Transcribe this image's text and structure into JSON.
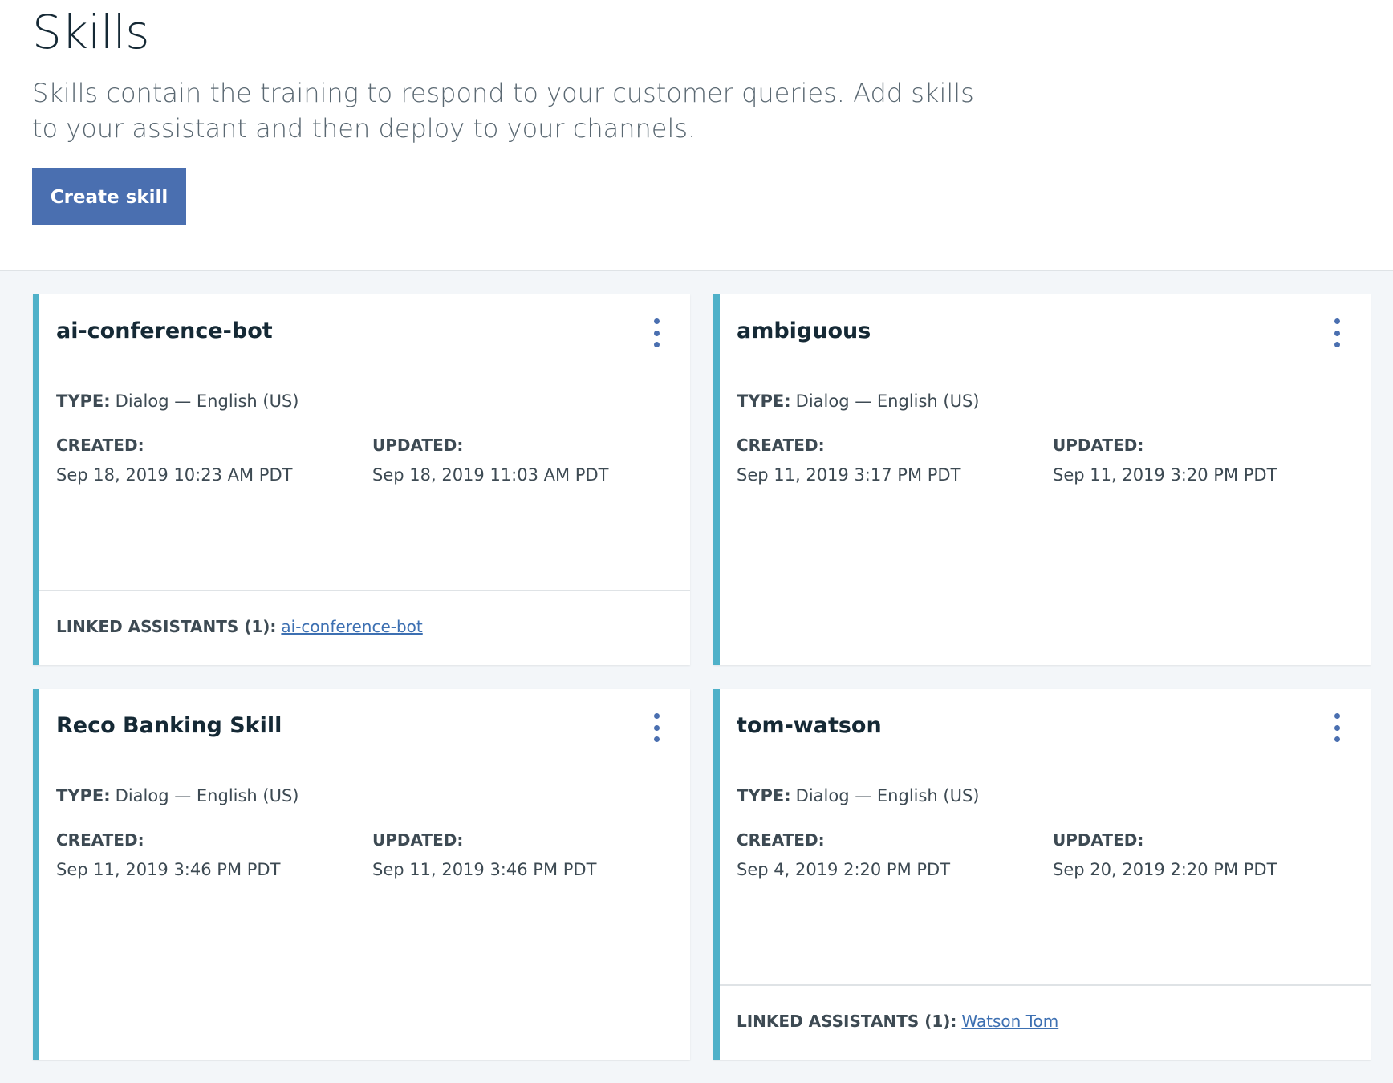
{
  "page": {
    "title": "Skills",
    "description": "Skills contain the training to respond to your customer queries. Add skills to your assistant and then deploy to your channels.",
    "create_label": "Create skill"
  },
  "labels": {
    "type": "TYPE:",
    "created": "CREATED:",
    "updated": "UPDATED:",
    "linked": "LINKED ASSISTANTS (1):"
  },
  "colors": {
    "accent": "#4a6fb0",
    "card_stripe": "#4fb1c9",
    "content_bg": "#f3f6f9"
  },
  "skills": [
    {
      "name": "ai-conference-bot",
      "type": "Dialog — English (US)",
      "created": "Sep 18, 2019 10:23 AM PDT",
      "updated": "Sep 18, 2019 11:03 AM PDT",
      "linked_assistant": "ai-conference-bot"
    },
    {
      "name": "ambiguous",
      "type": "Dialog — English (US)",
      "created": "Sep 11, 2019 3:17 PM PDT",
      "updated": "Sep 11, 2019 3:20 PM PDT"
    },
    {
      "name": "Reco Banking Skill",
      "type": "Dialog — English (US)",
      "created": "Sep 11, 2019 3:46 PM PDT",
      "updated": "Sep 11, 2019 3:46 PM PDT"
    },
    {
      "name": "tom-watson",
      "type": "Dialog — English (US)",
      "created": "Sep 4, 2019 2:20 PM PDT",
      "updated": "Sep 20, 2019 2:20 PM PDT",
      "linked_assistant": "Watson Tom"
    }
  ]
}
